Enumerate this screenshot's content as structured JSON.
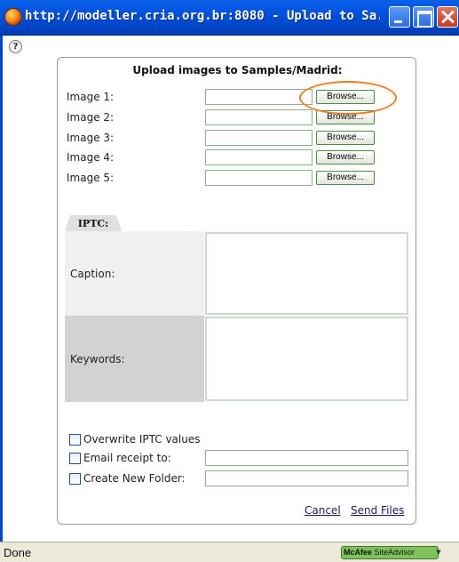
{
  "window": {
    "title": "http://modeller.cria.org.br:8080 - Upload to Sa...",
    "help_glyph": "?"
  },
  "form": {
    "title": "Upload images to Samples/Madrid:",
    "images": [
      {
        "label": "Image 1:",
        "value": "",
        "browse_label": "Browse..."
      },
      {
        "label": "Image 2:",
        "value": "",
        "browse_label": "Browse..."
      },
      {
        "label": "Image 3:",
        "value": "",
        "browse_label": "Browse..."
      },
      {
        "label": "Image 4:",
        "value": "",
        "browse_label": "Browse..."
      },
      {
        "label": "Image 5:",
        "value": "",
        "browse_label": "Browse..."
      }
    ],
    "iptc": {
      "tab_label": "IPTC:",
      "caption_label": "Caption:",
      "caption_value": "",
      "keywords_label": "Keywords:",
      "keywords_value": ""
    },
    "options": {
      "overwrite_label": "Overwrite IPTC values",
      "overwrite_checked": false,
      "email_label": "Email receipt to:",
      "email_checked": false,
      "email_value": "",
      "folder_label": "Create New Folder:",
      "folder_checked": false,
      "folder_value": ""
    },
    "cancel_label": "Cancel",
    "send_label": "Send Files"
  },
  "statusbar": {
    "text": "Done",
    "siteadvisor_brand": "McAfee",
    "siteadvisor_product": "SiteAdvisor",
    "siteadvisor_arrow": "▼"
  },
  "colors": {
    "titlebar": "#0053e0",
    "highlight": "#ee7e22",
    "field_border": "#8fb08f",
    "siteadvisor": "#7fc25c"
  }
}
